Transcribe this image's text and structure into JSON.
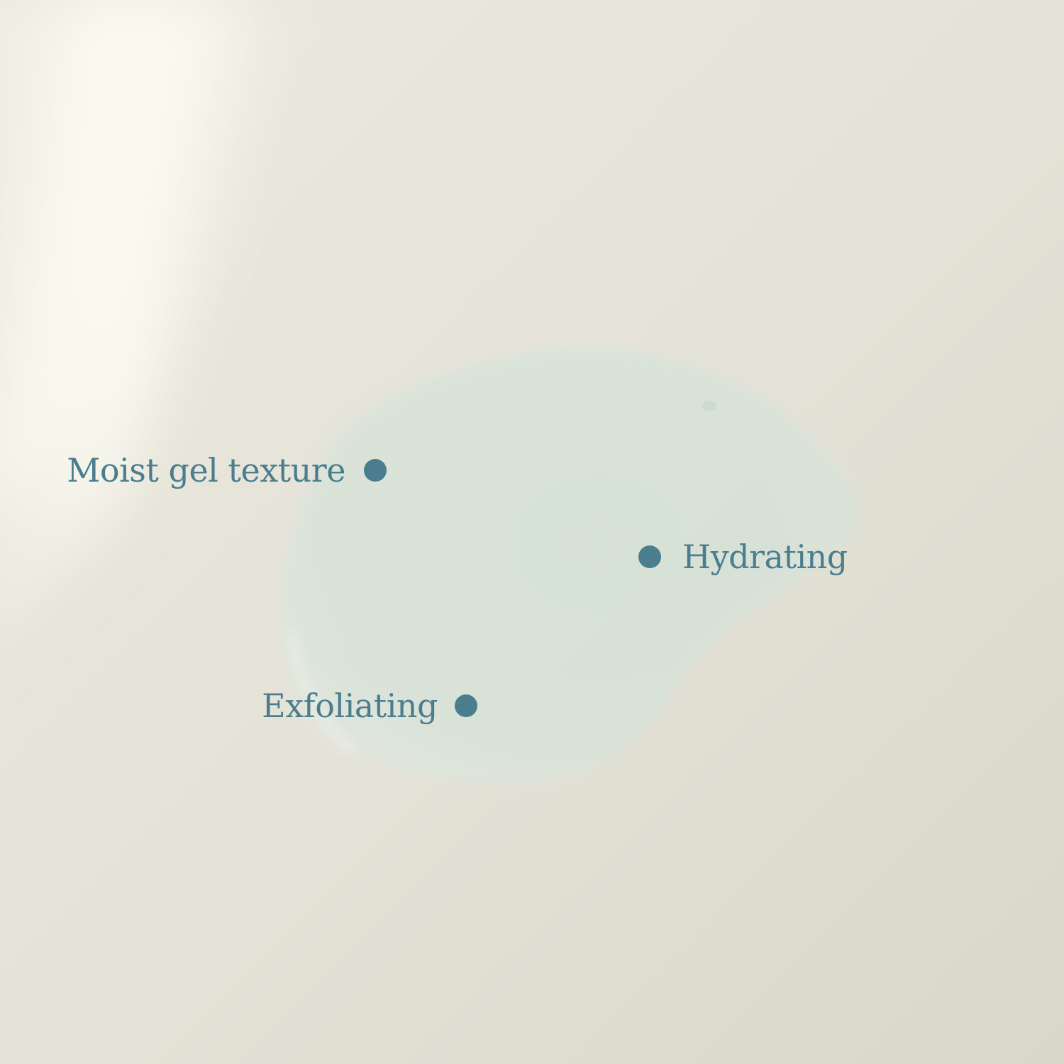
{
  "colors": {
    "background": "#e3e1d4",
    "background_light": "#f5f4e9",
    "gel": "#d6e2d8",
    "accent": "#4a7e8e"
  },
  "callouts": [
    {
      "label": "Moist gel texture"
    },
    {
      "label": "Hydrating"
    },
    {
      "label": "Exfoliating"
    }
  ]
}
